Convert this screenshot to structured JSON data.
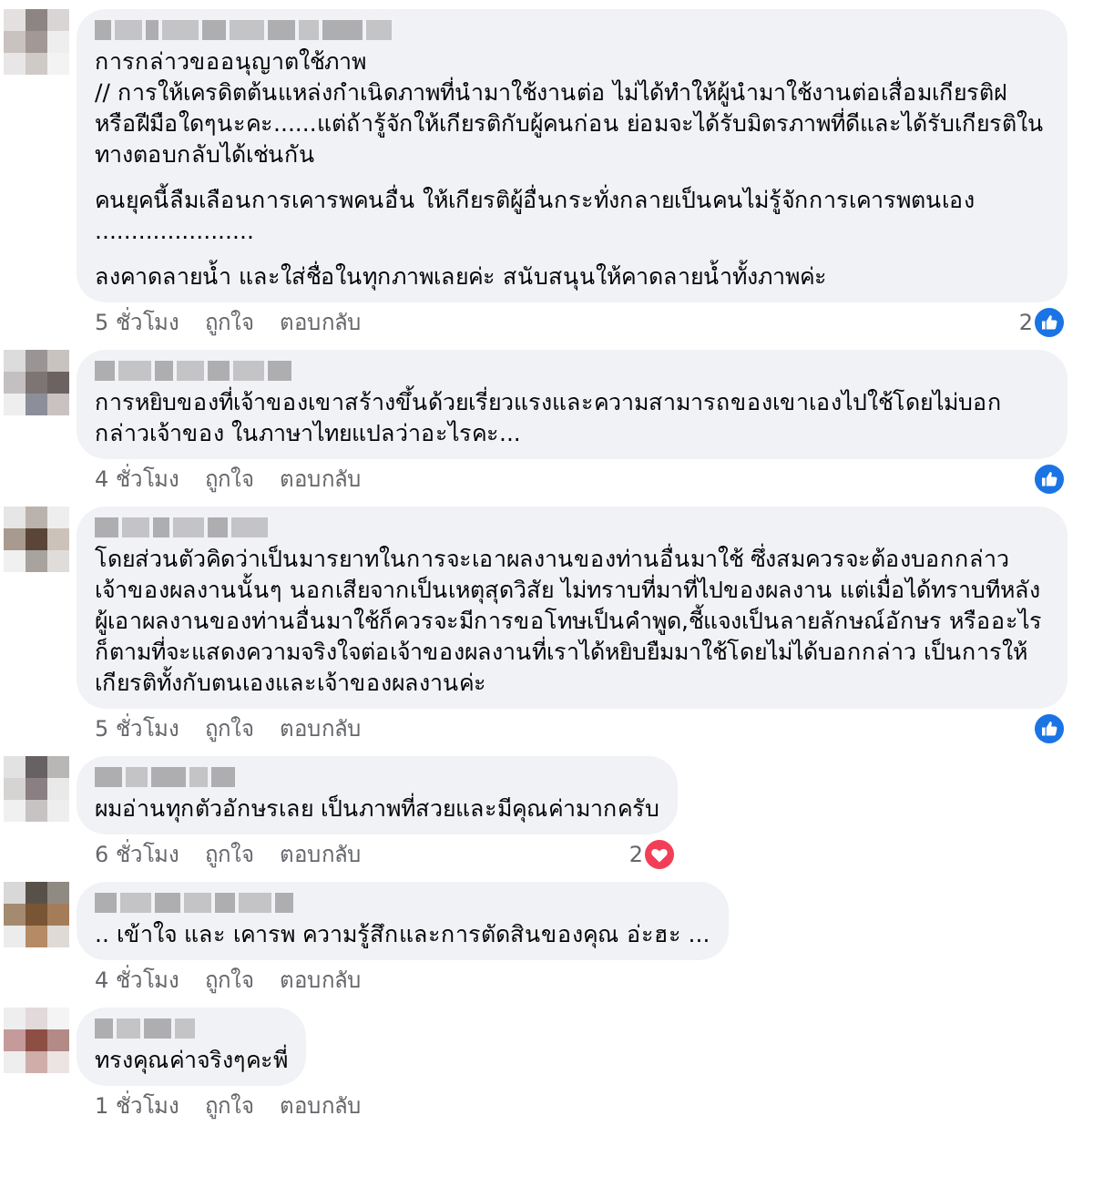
{
  "comments": [
    {
      "paragraphs": [
        "การกล่าวขออนุญาตใช้ภาพ\n// การให้เครดิตต้นแหล่งกำเนิดภาพที่นำมาใช้งานต่อ ไม่ได้ทำให้ผู้นำมาใช้งานต่อเสื่อมเกียรติฝ หรือฝีมือใดๆนะคะ......แต่ถ้ารู้จักให้เกียรติกับผู้คนก่อน ย่อมจะได้รับมิตรภาพที่ดีและได้รับเกียรติในทางตอบกลับได้เช่นกัน",
        "คนยุคนี้ลืมเลือนการเคารพคนอื่น ให้เกียรติผู้อื่นกระทั่งกลายเป็นคนไม่รู้จักการเคารพตนเอง\n......................",
        "ลงคาดลายน้ำ และใส่ชื่อในทุกภาพเลยค่ะ สนับสนุนให้คาดลายน้ำทั้งภาพค่ะ"
      ],
      "time": "5 ชั่วโมง",
      "like": "ถูกใจ",
      "reply": "ตอบกลับ",
      "reaction": {
        "kind": "like",
        "count": "2"
      }
    },
    {
      "paragraphs": [
        "การหยิบของที่เจ้าของเขาสร้างขึ้นด้วยเรี่ยวแรงและความสามารถของเขาเองไปใช้โดยไม่บอกกล่าวเจ้าของ ในภาษาไทยแปลว่าอะไรคะ..."
      ],
      "time": "4 ชั่วโมง",
      "like": "ถูกใจ",
      "reply": "ตอบกลับ",
      "reaction": {
        "kind": "like"
      }
    },
    {
      "paragraphs": [
        "โดยส่วนตัวคิดว่าเป็นมารยาทในการจะเอาผลงานของท่านอื่นมาใช้ ซึ่งสมควรจะต้องบอกกล่าวเจ้าของผลงานนั้นๆ นอกเสียจากเป็นเหตุสุดวิสัย ไม่ทราบที่มาที่ไปของผลงาน แต่เมื่อได้ทราบทีหลัง ผู้เอาผลงานของท่านอื่นมาใช้ก็ควรจะมีการขอโทษเป็นคำพูด,ชี้แจงเป็นลายลักษณ์อักษร หรืออะไรก็ตามที่จะแสดงความจริงใจต่อเจ้าของผลงานที่เราได้หยิบยืมมาใช้โดยไม่ได้บอกกล่าว เป็นการให้เกียรติทั้งกับตนเองและเจ้าของผลงานค่ะ"
      ],
      "time": "5 ชั่วโมง",
      "like": "ถูกใจ",
      "reply": "ตอบกลับ",
      "reaction": {
        "kind": "like"
      }
    },
    {
      "paragraphs": [
        "ผมอ่านทุกตัวอักษรเลย เป็นภาพที่สวยและมีคุณค่ามากครับ"
      ],
      "time": "6 ชั่วโมง",
      "like": "ถูกใจ",
      "reply": "ตอบกลับ",
      "reaction": {
        "kind": "love",
        "count": "2"
      }
    },
    {
      "paragraphs": [
        ".. เข้าใจ และ เคารพ ความรู้สึกและการตัดสินของคุณ อ่ะฮะ ..."
      ],
      "time": "4 ชั่วโมง",
      "like": "ถูกใจ",
      "reply": "ตอบกลับ"
    },
    {
      "paragraphs": [
        "ทรงคุณค่าจริงๆคะพี่"
      ],
      "time": "1 ชั่วโมง",
      "like": "ถูกใจ",
      "reply": "ตอบกลับ"
    }
  ]
}
